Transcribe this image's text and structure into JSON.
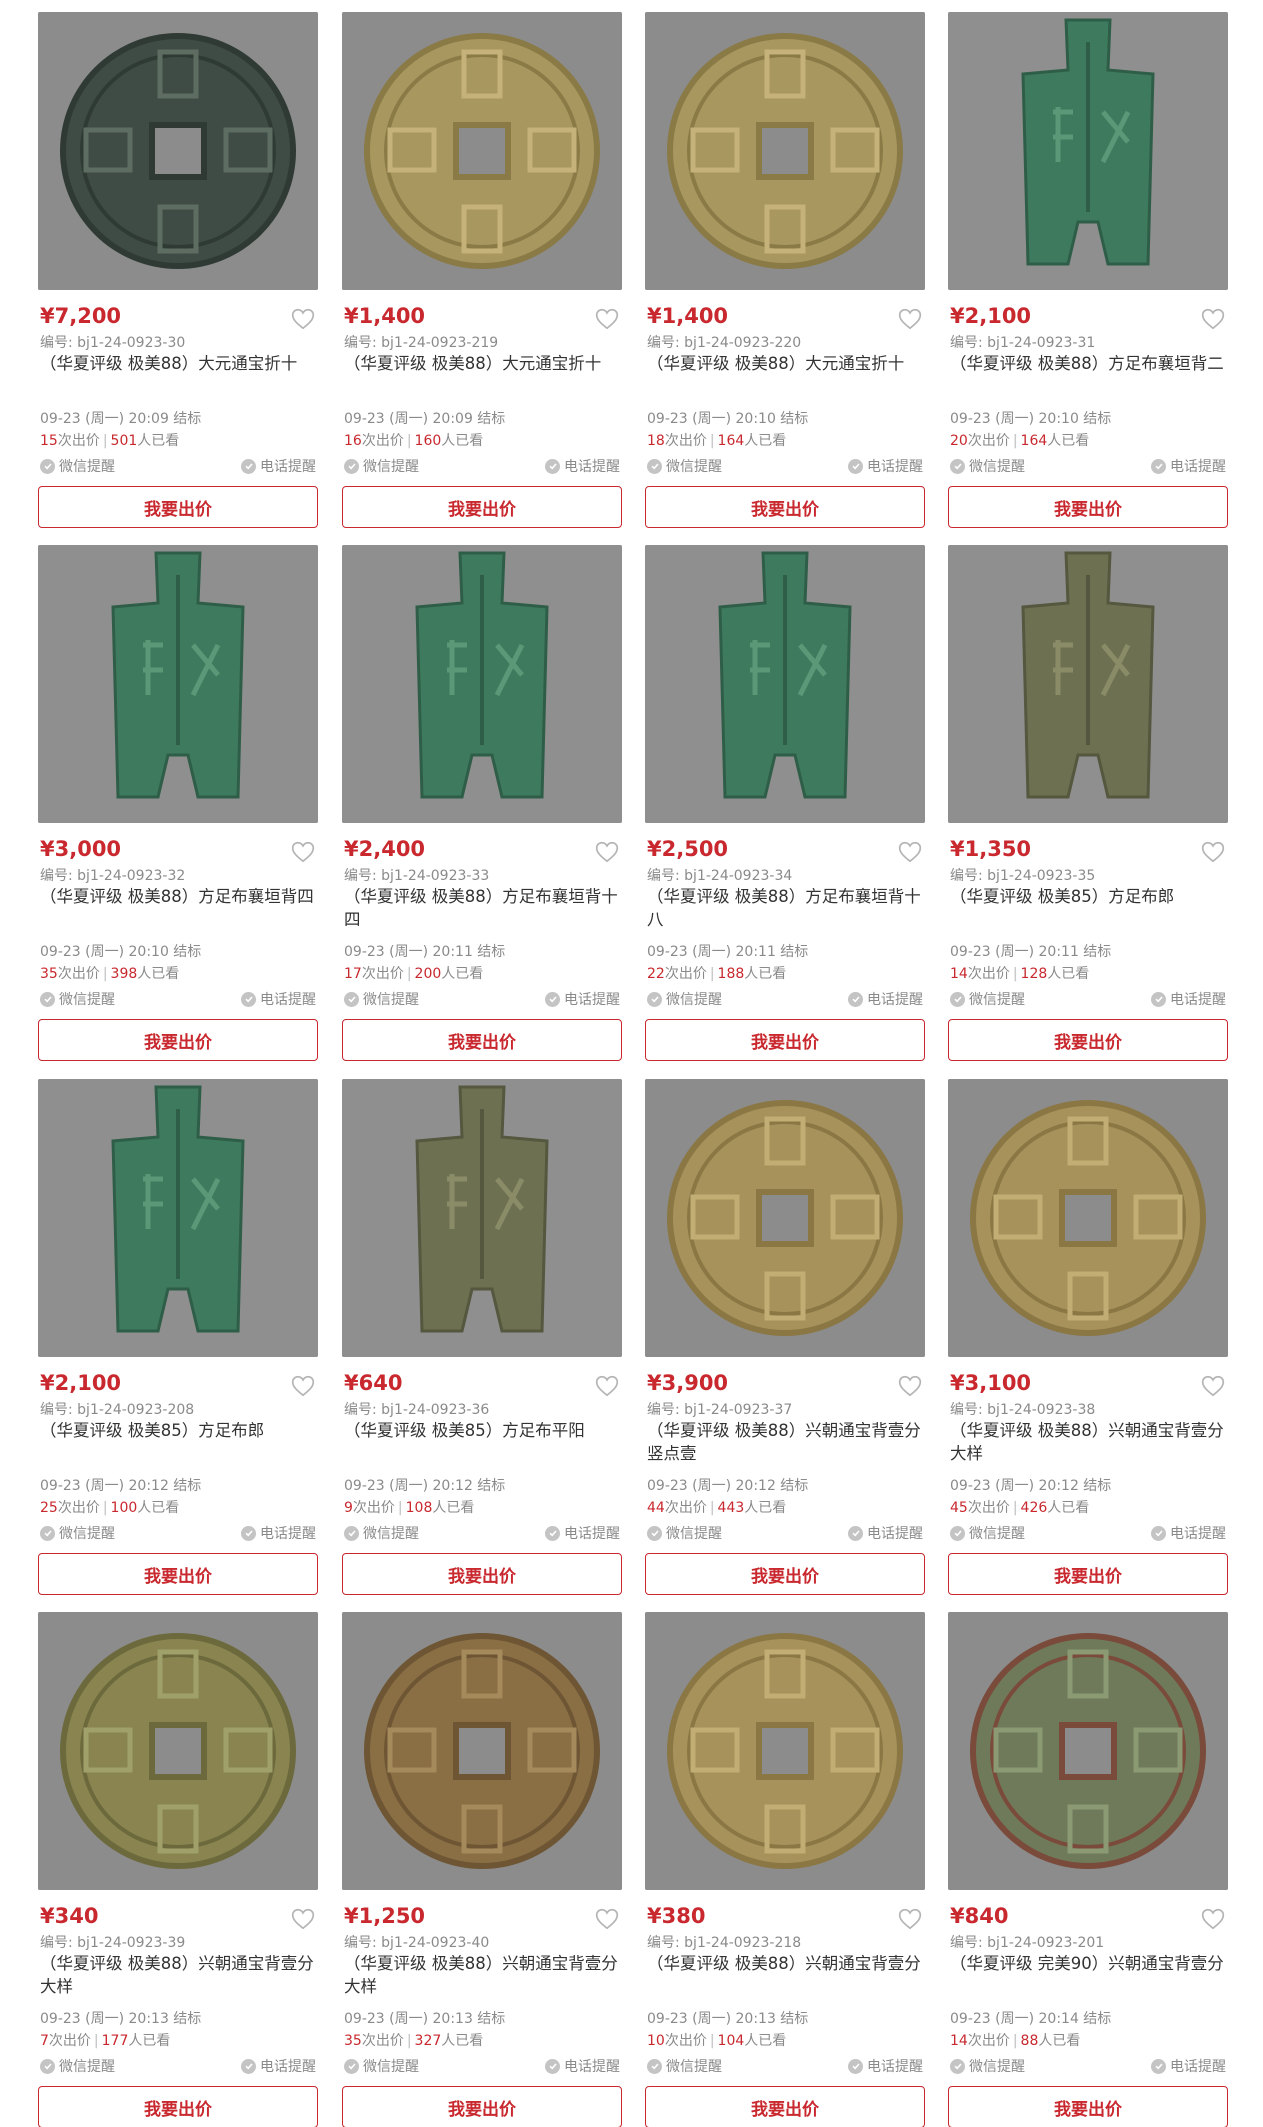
{
  "labels": {
    "lot_prefix": "编号: ",
    "bids_suffix": "次出价",
    "viewers_suffix": "人已看",
    "wechat_remind": "微信提醒",
    "phone_remind": "电话提醒",
    "bid_button": "我要出价"
  },
  "colors": {
    "accent": "#c8282e",
    "muted": "#8a8a8a",
    "text": "#333333"
  },
  "items": [
    {
      "price": "¥7,200",
      "lot": "bj1-24-0923-30",
      "title": "（华夏评级 极美88）大元通宝折十",
      "end": "09-23 (周一) 20:09 结标",
      "bids": "15",
      "views": "501",
      "image": "round-coin-dayuan-patina"
    },
    {
      "price": "¥1,400",
      "lot": "bj1-24-0923-219",
      "title": "（华夏评级 极美88）大元通宝折十",
      "end": "09-23 (周一) 20:09 结标",
      "bids": "16",
      "views": "160",
      "image": "round-coin-dayuan-brass"
    },
    {
      "price": "¥1,400",
      "lot": "bj1-24-0923-220",
      "title": "（华夏评级 极美88）大元通宝折十",
      "end": "09-23 (周一) 20:10 结标",
      "bids": "18",
      "views": "164",
      "image": "round-coin-dayuan-brass"
    },
    {
      "price": "¥2,100",
      "lot": "bj1-24-0923-31",
      "title": "（华夏评级 极美88）方足布襄垣背二",
      "end": "09-23 (周一) 20:10 结标",
      "bids": "20",
      "views": "164",
      "image": "spade-coin-green"
    },
    {
      "price": "¥3,000",
      "lot": "bj1-24-0923-32",
      "title": "（华夏评级 极美88）方足布襄垣背四",
      "end": "09-23 (周一) 20:10 结标",
      "bids": "35",
      "views": "398",
      "image": "spade-coin-green"
    },
    {
      "price": "¥2,400",
      "lot": "bj1-24-0923-33",
      "title": "（华夏评级 极美88）方足布襄垣背十四",
      "end": "09-23 (周一) 20:11 结标",
      "bids": "17",
      "views": "200",
      "image": "spade-coin-green"
    },
    {
      "price": "¥2,500",
      "lot": "bj1-24-0923-34",
      "title": "（华夏评级 极美88）方足布襄垣背十八",
      "end": "09-23 (周一) 20:11 结标",
      "bids": "22",
      "views": "188",
      "image": "spade-coin-green"
    },
    {
      "price": "¥1,350",
      "lot": "bj1-24-0923-35",
      "title": "（华夏评级 极美85）方足布郎",
      "end": "09-23 (周一) 20:11 结标",
      "bids": "14",
      "views": "128",
      "image": "spade-coin-olive"
    },
    {
      "price": "¥2,100",
      "lot": "bj1-24-0923-208",
      "title": "（华夏评级 极美85）方足布郎",
      "end": "09-23 (周一) 20:12 结标",
      "bids": "25",
      "views": "100",
      "image": "spade-coin-green"
    },
    {
      "price": "¥640",
      "lot": "bj1-24-0923-36",
      "title": "（华夏评级 极美85）方足布平阳",
      "end": "09-23 (周一) 20:12 结标",
      "bids": "9",
      "views": "108",
      "image": "spade-coin-olive"
    },
    {
      "price": "¥3,900",
      "lot": "bj1-24-0923-37",
      "title": "（华夏评级 极美88）兴朝通宝背壹分竖点壹",
      "end": "09-23 (周一) 20:12 结标",
      "bids": "44",
      "views": "443",
      "image": "round-coin-xingchao-brass"
    },
    {
      "price": "¥3,100",
      "lot": "bj1-24-0923-38",
      "title": "（华夏评级 极美88）兴朝通宝背壹分大样",
      "end": "09-23 (周一) 20:12 结标",
      "bids": "45",
      "views": "426",
      "image": "round-coin-xingchao-brass"
    },
    {
      "price": "¥340",
      "lot": "bj1-24-0923-39",
      "title": "（华夏评级 极美88）兴朝通宝背壹分大样",
      "end": "09-23 (周一) 20:13 结标",
      "bids": "7",
      "views": "177",
      "image": "round-coin-xingchao-green"
    },
    {
      "price": "¥1,250",
      "lot": "bj1-24-0923-40",
      "title": "（华夏评级 极美88）兴朝通宝背壹分大样",
      "end": "09-23 (周一) 20:13 结标",
      "bids": "35",
      "views": "327",
      "image": "round-coin-xingchao-bronze"
    },
    {
      "price": "¥380",
      "lot": "bj1-24-0923-218",
      "title": "（华夏评级 极美88）兴朝通宝背壹分",
      "end": "09-23 (周一) 20:13 结标",
      "bids": "10",
      "views": "104",
      "image": "round-coin-xingchao-brass"
    },
    {
      "price": "¥840",
      "lot": "bj1-24-0923-201",
      "title": "（华夏评级 完美90）兴朝通宝背壹分",
      "end": "09-23 (周一) 20:14 结标",
      "bids": "14",
      "views": "88",
      "image": "round-coin-xingchao-patina"
    }
  ]
}
